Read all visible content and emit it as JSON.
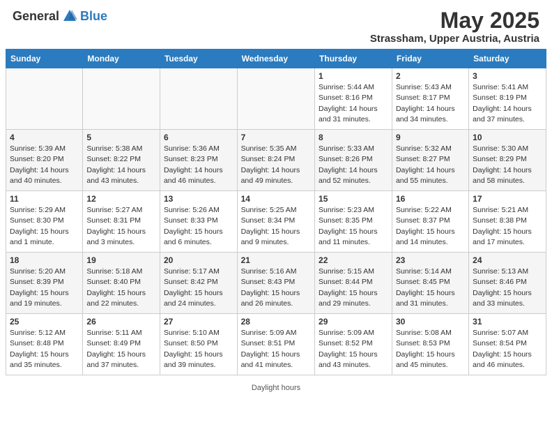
{
  "header": {
    "logo_general": "General",
    "logo_blue": "Blue",
    "month": "May 2025",
    "location": "Strassham, Upper Austria, Austria"
  },
  "days_of_week": [
    "Sunday",
    "Monday",
    "Tuesday",
    "Wednesday",
    "Thursday",
    "Friday",
    "Saturday"
  ],
  "weeks": [
    [
      {
        "day": "",
        "info": ""
      },
      {
        "day": "",
        "info": ""
      },
      {
        "day": "",
        "info": ""
      },
      {
        "day": "",
        "info": ""
      },
      {
        "day": "1",
        "info": "Sunrise: 5:44 AM\nSunset: 8:16 PM\nDaylight: 14 hours\nand 31 minutes."
      },
      {
        "day": "2",
        "info": "Sunrise: 5:43 AM\nSunset: 8:17 PM\nDaylight: 14 hours\nand 34 minutes."
      },
      {
        "day": "3",
        "info": "Sunrise: 5:41 AM\nSunset: 8:19 PM\nDaylight: 14 hours\nand 37 minutes."
      }
    ],
    [
      {
        "day": "4",
        "info": "Sunrise: 5:39 AM\nSunset: 8:20 PM\nDaylight: 14 hours\nand 40 minutes."
      },
      {
        "day": "5",
        "info": "Sunrise: 5:38 AM\nSunset: 8:22 PM\nDaylight: 14 hours\nand 43 minutes."
      },
      {
        "day": "6",
        "info": "Sunrise: 5:36 AM\nSunset: 8:23 PM\nDaylight: 14 hours\nand 46 minutes."
      },
      {
        "day": "7",
        "info": "Sunrise: 5:35 AM\nSunset: 8:24 PM\nDaylight: 14 hours\nand 49 minutes."
      },
      {
        "day": "8",
        "info": "Sunrise: 5:33 AM\nSunset: 8:26 PM\nDaylight: 14 hours\nand 52 minutes."
      },
      {
        "day": "9",
        "info": "Sunrise: 5:32 AM\nSunset: 8:27 PM\nDaylight: 14 hours\nand 55 minutes."
      },
      {
        "day": "10",
        "info": "Sunrise: 5:30 AM\nSunset: 8:29 PM\nDaylight: 14 hours\nand 58 minutes."
      }
    ],
    [
      {
        "day": "11",
        "info": "Sunrise: 5:29 AM\nSunset: 8:30 PM\nDaylight: 15 hours\nand 1 minute."
      },
      {
        "day": "12",
        "info": "Sunrise: 5:27 AM\nSunset: 8:31 PM\nDaylight: 15 hours\nand 3 minutes."
      },
      {
        "day": "13",
        "info": "Sunrise: 5:26 AM\nSunset: 8:33 PM\nDaylight: 15 hours\nand 6 minutes."
      },
      {
        "day": "14",
        "info": "Sunrise: 5:25 AM\nSunset: 8:34 PM\nDaylight: 15 hours\nand 9 minutes."
      },
      {
        "day": "15",
        "info": "Sunrise: 5:23 AM\nSunset: 8:35 PM\nDaylight: 15 hours\nand 11 minutes."
      },
      {
        "day": "16",
        "info": "Sunrise: 5:22 AM\nSunset: 8:37 PM\nDaylight: 15 hours\nand 14 minutes."
      },
      {
        "day": "17",
        "info": "Sunrise: 5:21 AM\nSunset: 8:38 PM\nDaylight: 15 hours\nand 17 minutes."
      }
    ],
    [
      {
        "day": "18",
        "info": "Sunrise: 5:20 AM\nSunset: 8:39 PM\nDaylight: 15 hours\nand 19 minutes."
      },
      {
        "day": "19",
        "info": "Sunrise: 5:18 AM\nSunset: 8:40 PM\nDaylight: 15 hours\nand 22 minutes."
      },
      {
        "day": "20",
        "info": "Sunrise: 5:17 AM\nSunset: 8:42 PM\nDaylight: 15 hours\nand 24 minutes."
      },
      {
        "day": "21",
        "info": "Sunrise: 5:16 AM\nSunset: 8:43 PM\nDaylight: 15 hours\nand 26 minutes."
      },
      {
        "day": "22",
        "info": "Sunrise: 5:15 AM\nSunset: 8:44 PM\nDaylight: 15 hours\nand 29 minutes."
      },
      {
        "day": "23",
        "info": "Sunrise: 5:14 AM\nSunset: 8:45 PM\nDaylight: 15 hours\nand 31 minutes."
      },
      {
        "day": "24",
        "info": "Sunrise: 5:13 AM\nSunset: 8:46 PM\nDaylight: 15 hours\nand 33 minutes."
      }
    ],
    [
      {
        "day": "25",
        "info": "Sunrise: 5:12 AM\nSunset: 8:48 PM\nDaylight: 15 hours\nand 35 minutes."
      },
      {
        "day": "26",
        "info": "Sunrise: 5:11 AM\nSunset: 8:49 PM\nDaylight: 15 hours\nand 37 minutes."
      },
      {
        "day": "27",
        "info": "Sunrise: 5:10 AM\nSunset: 8:50 PM\nDaylight: 15 hours\nand 39 minutes."
      },
      {
        "day": "28",
        "info": "Sunrise: 5:09 AM\nSunset: 8:51 PM\nDaylight: 15 hours\nand 41 minutes."
      },
      {
        "day": "29",
        "info": "Sunrise: 5:09 AM\nSunset: 8:52 PM\nDaylight: 15 hours\nand 43 minutes."
      },
      {
        "day": "30",
        "info": "Sunrise: 5:08 AM\nSunset: 8:53 PM\nDaylight: 15 hours\nand 45 minutes."
      },
      {
        "day": "31",
        "info": "Sunrise: 5:07 AM\nSunset: 8:54 PM\nDaylight: 15 hours\nand 46 minutes."
      }
    ]
  ],
  "footer": "Daylight hours"
}
